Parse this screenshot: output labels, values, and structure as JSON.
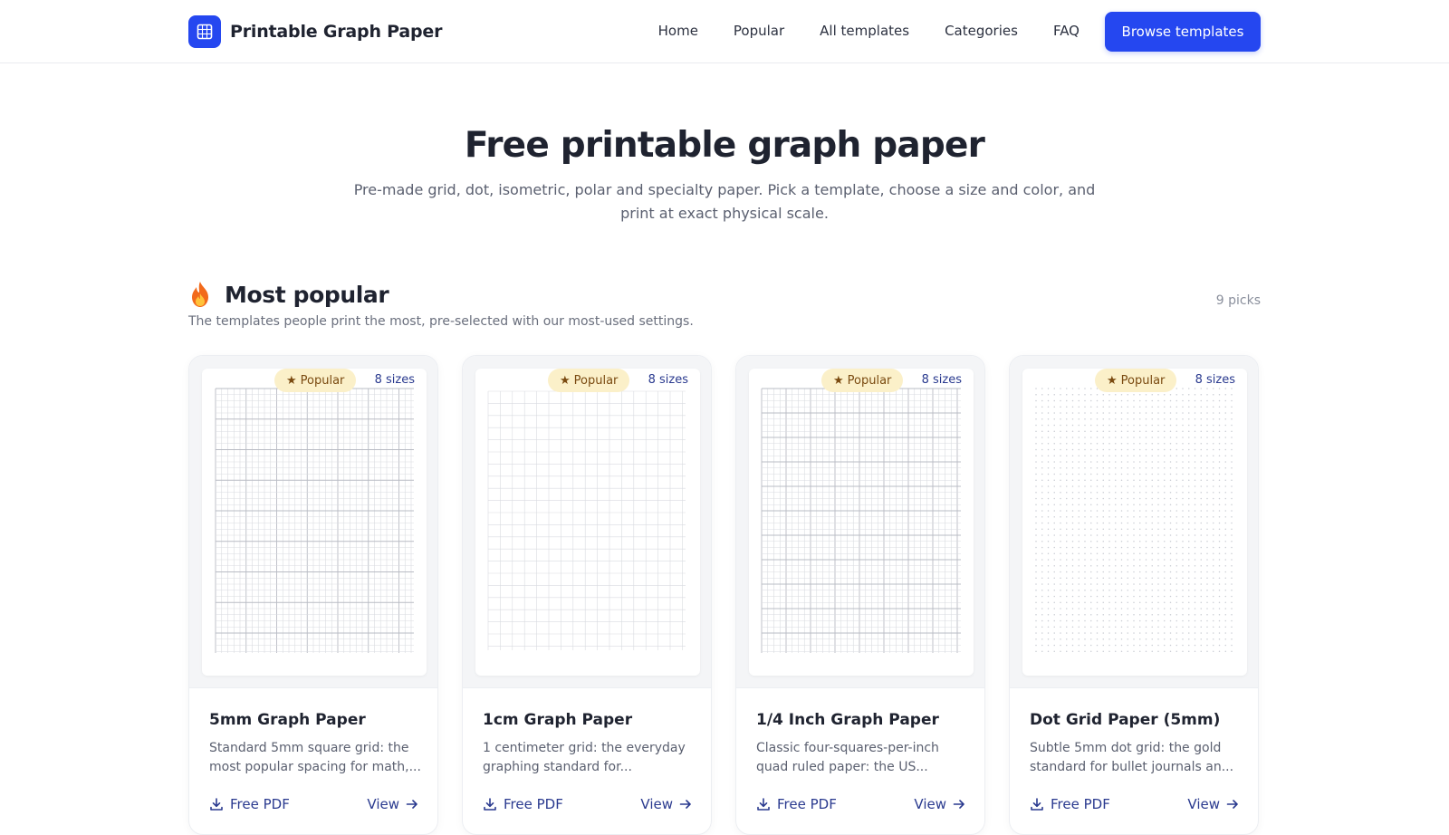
{
  "brand": {
    "name": "Printable Graph Paper",
    "icon": "grid-icon",
    "accent": "#2547f0"
  },
  "nav": {
    "items": [
      {
        "label": "Home"
      },
      {
        "label": "Popular"
      },
      {
        "label": "All templates"
      },
      {
        "label": "Categories"
      },
      {
        "label": "FAQ"
      }
    ],
    "cta_label": "Browse templates"
  },
  "hero": {
    "title": "Free printable graph paper",
    "subtitle": "Pre-made grid, dot, isometric, polar and specialty paper. Pick a template, choose a size and color, and print at exact physical scale."
  },
  "section": {
    "icon": "fire-icon",
    "title": "Most popular",
    "description": "The templates people print the most, pre-selected with our most-used settings.",
    "count": "9 picks"
  },
  "cards": [
    {
      "badge": "Popular",
      "sizes": "8 sizes",
      "title": "5mm Graph Paper",
      "description": "Standard 5mm square grid: the most popular spacing for math,...",
      "pdf_label": "Free PDF",
      "view_label": "View",
      "pattern": "grid-fine"
    },
    {
      "badge": "Popular",
      "sizes": "8 sizes",
      "title": "1cm Graph Paper",
      "description": "1 centimeter grid: the everyday graphing standard for...",
      "pdf_label": "Free PDF",
      "view_label": "View",
      "pattern": "grid-cm"
    },
    {
      "badge": "Popular",
      "sizes": "8 sizes",
      "title": "1/4 Inch Graph Paper",
      "description": "Classic four-squares-per-inch quad ruled paper: the US...",
      "pdf_label": "Free PDF",
      "view_label": "View",
      "pattern": "grid-quarter-inch"
    },
    {
      "badge": "Popular",
      "sizes": "8 sizes",
      "title": "Dot Grid Paper (5mm)",
      "description": "Subtle 5mm dot grid: the gold standard for bullet journals an...",
      "pdf_label": "Free PDF",
      "view_label": "View",
      "pattern": "dot-grid"
    }
  ],
  "colors": {
    "badge_bg": "#fbf0c9",
    "badge_text": "#7a4a10",
    "link": "#2a3a8f"
  }
}
